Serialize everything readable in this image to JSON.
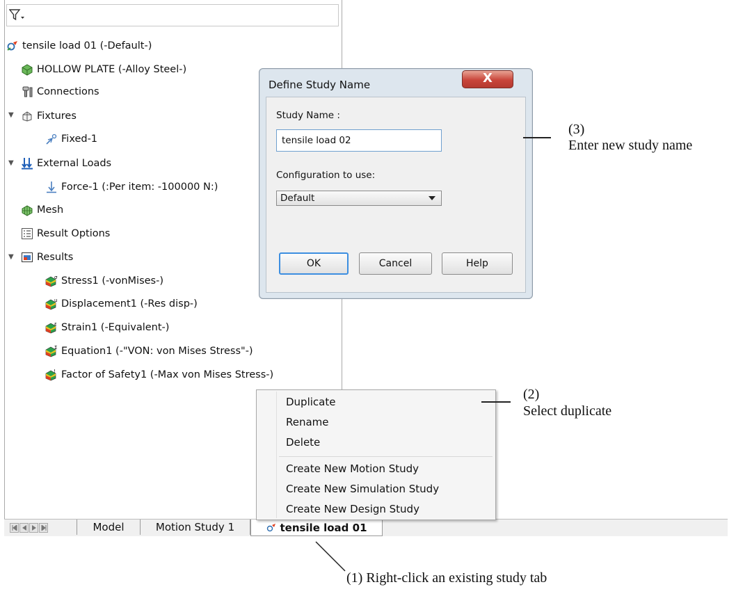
{
  "tree": {
    "root": "tensile load 01 (-Default-)",
    "items": [
      {
        "label": "HOLLOW PLATE (-Alloy Steel-)",
        "icon": "part-icon"
      },
      {
        "label": "Connections",
        "icon": "connections-icon"
      },
      {
        "label": "Fixtures",
        "icon": "fixtures-icon"
      },
      {
        "label": "Fixed-1",
        "icon": "fixed-icon"
      },
      {
        "label": "External Loads",
        "icon": "external-loads-icon"
      },
      {
        "label": "Force-1 (:Per item: -100000 N:)",
        "icon": "force-icon"
      },
      {
        "label": "Mesh",
        "icon": "mesh-icon"
      },
      {
        "label": "Result Options",
        "icon": "result-options-icon"
      },
      {
        "label": "Results",
        "icon": "results-folder-icon"
      },
      {
        "label": "Stress1 (-vonMises-)",
        "icon": "stress-plot-icon"
      },
      {
        "label": "Displacement1 (-Res disp-)",
        "icon": "displacement-plot-icon"
      },
      {
        "label": "Strain1 (-Equivalent-)",
        "icon": "strain-plot-icon"
      },
      {
        "label": "Equation1 (-\"VON: von Mises Stress\"-)",
        "icon": "equation-plot-icon"
      },
      {
        "label": "Factor of Safety1 (-Max von Mises Stress-)",
        "icon": "factor-of-safety-icon"
      }
    ]
  },
  "tabs": {
    "items": [
      "Model",
      "Motion Study 1",
      "tensile load 01"
    ],
    "active": "tensile load 01"
  },
  "dialog": {
    "title": "Define Study Name",
    "close_label": "X",
    "study_name_label": "Study Name :",
    "study_name_value": "tensile load 02",
    "config_label": "Configuration to use:",
    "config_value": "Default",
    "ok": "OK",
    "cancel": "Cancel",
    "help": "Help"
  },
  "context_menu": {
    "items": [
      "Duplicate",
      "Rename",
      "Delete",
      "Create New Motion Study",
      "Create New Simulation Study",
      "Create New Design Study"
    ]
  },
  "annotations": {
    "step3_num": "(3)",
    "step3_text": "Enter new study name",
    "step2_num": "(2)",
    "step2_text": "Select duplicate",
    "step1_text": "(1)  Right-click an existing study tab"
  },
  "colors": {
    "plot_icon": "#e04020",
    "folder_icon": "#2b6cb0",
    "load_icon": "#1f5fb8",
    "dialog_close": "#c9453a",
    "focus": "#3c8ee0"
  }
}
